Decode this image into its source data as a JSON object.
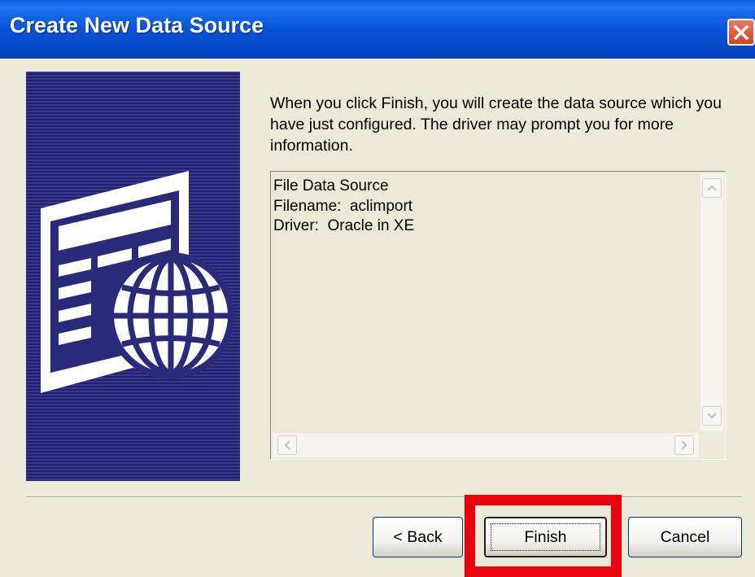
{
  "window": {
    "title": "Create New Data Source"
  },
  "description": "When you click Finish, you will create the data source which you have just configured.  The driver may prompt you for more information.",
  "summary": {
    "lines": [
      "File Data Source",
      "Filename:  aclimport",
      "Driver:  Oracle in XE"
    ]
  },
  "buttons": {
    "back": "< Back",
    "finish": "Finish",
    "cancel": "Cancel"
  },
  "colors": {
    "titlebar": "#0553D6",
    "highlight": "#E8000B",
    "panel": "#2A2A7A"
  },
  "icons": {
    "close": "close-icon",
    "side": "data-source-globe-icon"
  }
}
